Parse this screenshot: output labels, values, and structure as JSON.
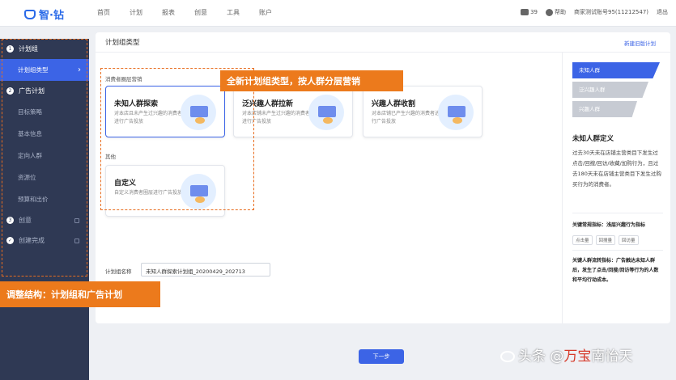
{
  "logo": {
    "text": "智·钻"
  },
  "nav": [
    "首页",
    "计划",
    "报表",
    "创意",
    "工具",
    "账户"
  ],
  "top_right": {
    "messages": "39",
    "help": "帮助",
    "account": "商家测试账号95(11212547)",
    "logout": "退出"
  },
  "sidebar": {
    "groups": [
      {
        "num": "1",
        "label": "计划组"
      },
      {
        "num": "2",
        "label": "广告计划"
      },
      {
        "num": "3",
        "label": "创意"
      },
      {
        "num": "✓",
        "label": "创建完成"
      }
    ],
    "plan_group_items": [
      "计划组类型"
    ],
    "ad_plan_items": [
      "目标策略",
      "基本信息",
      "定向人群",
      "资源位",
      "预算和出价"
    ]
  },
  "overlays": {
    "top": "全新计划组类型，按人群分层营销",
    "bottom": "调整结构：计划组和广告计划"
  },
  "main": {
    "title": "计划组类型",
    "new_link": "新建旧版计划",
    "section1": "消费者圈层营销",
    "section2": "其他",
    "cards": [
      {
        "title": "未知人群探索",
        "desc": "对本店且未产生过兴趣的消费者进行广告投放"
      },
      {
        "title": "泛兴趣人群拉新",
        "desc": "对本店铺未产生过兴趣的消费者进行广告投放"
      },
      {
        "title": "兴趣人群收割",
        "desc": "对本店铺已产生兴趣的消费者进行广告投放"
      },
      {
        "title": "自定义",
        "desc": "自定义消费者圈层进行广告投放"
      }
    ],
    "plan_name_label": "计划组名称",
    "plan_name_value": "未知人群探索计划组_20200429_202713"
  },
  "right_panel": {
    "steps": [
      "未知人群",
      "泛兴趣人群",
      "兴趣人群"
    ],
    "title": "未知人群定义",
    "text": "过去30天未在店铺主营类目下发生过点击/回搜/回访/收藏/加购行为，且过去180天未在店铺主营类目下发生过购买行为的消费者。",
    "key_metric": "关键常规指标：浅层兴趣行为指标",
    "tags": [
      "点击量",
      "回搜量",
      "回访量"
    ],
    "flow_metric": "关键人群流转指标：广告触达未知人群后，发生了点击/回搜/回访等行为的人数和平均行动成本。"
  },
  "next_button": "下一步",
  "watermark": {
    "prefix": "头条 @",
    "red": "万宝",
    "suffix": "南怡天"
  }
}
